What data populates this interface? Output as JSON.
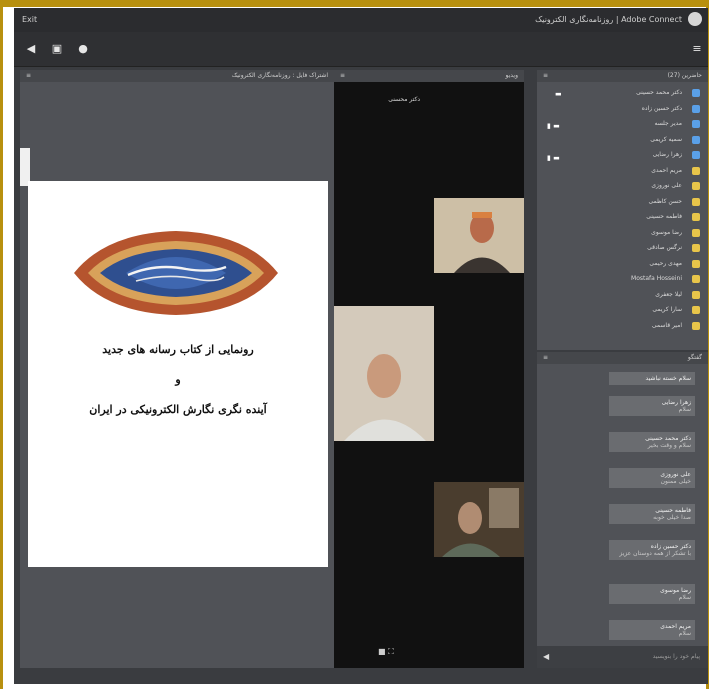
{
  "window": {
    "title": "روزنامه‌نگاری الکترونیک | Adobe Connect",
    "left_label": "Exit",
    "accent_gold": "#b8900f"
  },
  "toolbar": {
    "icons": [
      "speaker-icon",
      "screen-icon",
      "person-icon",
      "menu-icon"
    ]
  },
  "share_pod": {
    "title": "اشتراک فایل : روزنامه‌نگاری الکترونیک",
    "document": {
      "line1": "رونمایی از کتاب رسانه های جدید",
      "line2": "و",
      "line3": "آینده نگری نگارش الکترونیکی در ایران"
    }
  },
  "video_pod": {
    "title": "ویدیو",
    "speaker_label": "دکتر محسنی"
  },
  "attendees_pod": {
    "title": "حاضرین (27)",
    "people": [
      "دکتر محمد حسینی",
      "دکتر حسین زاده",
      "مدیر جلسه",
      "سمیه کریمی",
      "زهرا رضایی",
      "مریم احمدی",
      "علی نوروزی",
      "حسن کاظمی",
      "فاطمه حسینی",
      "رضا موسوی",
      "نرگس صادقی",
      "مهدی رحیمی",
      "Mostafa Hosseini",
      "لیلا جعفری",
      "سارا کریمی",
      "امیر قاسمی"
    ]
  },
  "chat_pod": {
    "title": "گفتگو",
    "messages": [
      {
        "who": "سلام خسته نباشید",
        "body": ""
      },
      {
        "who": "زهرا رضایی",
        "body": "سلام"
      },
      {
        "who": "دکتر محمد حسینی",
        "body": "سلام و وقت بخیر"
      },
      {
        "who": "علی نوروزی",
        "body": "خیلی ممنون"
      },
      {
        "who": "فاطمه حسینی",
        "body": "صدا خیلی خوبه"
      },
      {
        "who": "دکتر حسین زاده",
        "body": "با تشکر از همه دوستان عزیز"
      },
      {
        "who": "رضا موسوی",
        "body": "سلام"
      },
      {
        "who": "مریم احمدی",
        "body": "سلام"
      }
    ],
    "input_placeholder": "پیام خود را بنویسید"
  }
}
